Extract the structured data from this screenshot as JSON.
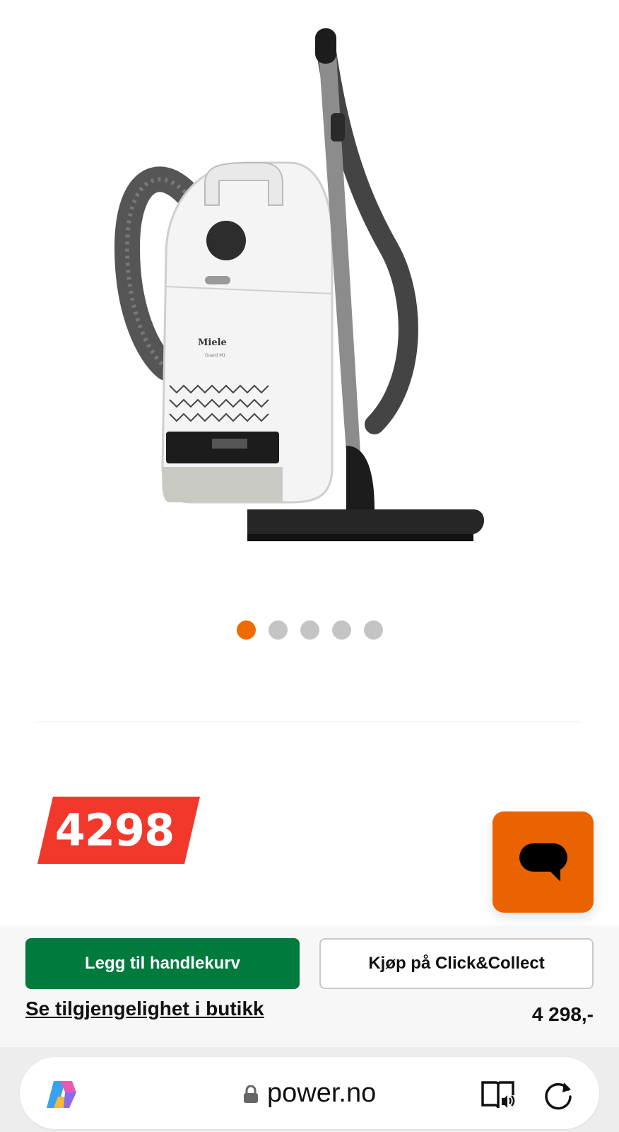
{
  "product": {
    "brand": "Miele",
    "model": "Guard M1",
    "image_dots": 5,
    "active_dot": 0
  },
  "price": {
    "badge": "4298",
    "formatted": "4 298,-"
  },
  "actions": {
    "add_to_cart": "Legg til handlekurv",
    "click_collect": "Kjøp på Click&Collect",
    "store_availability": "Se tilgjengelighet i butikk"
  },
  "browser": {
    "url": "power.no"
  },
  "colors": {
    "accent_orange": "#ef6b00",
    "chat_orange": "#ea6300",
    "price_red": "#f2382b",
    "cart_green": "#007a3d"
  },
  "icons": [
    "chat-icon",
    "copilot-icon",
    "lock-icon",
    "reader-icon",
    "reload-icon"
  ]
}
